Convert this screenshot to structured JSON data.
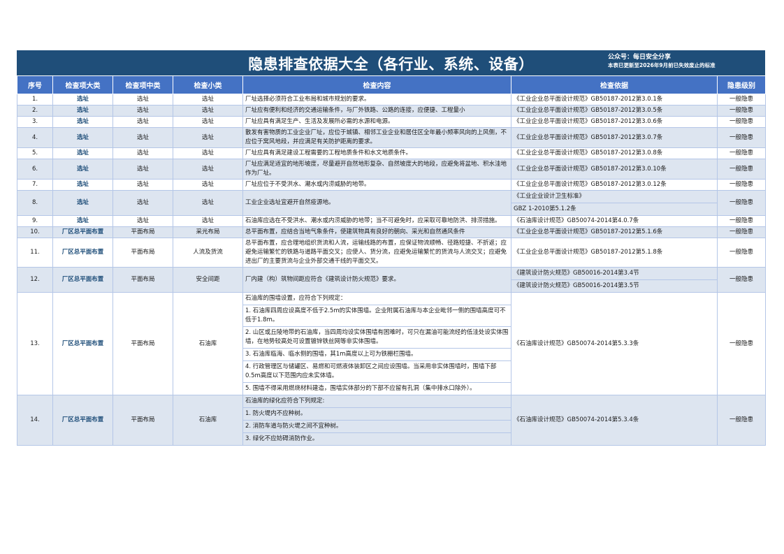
{
  "title": {
    "main": "隐患排查依据大全（各行业、系统、设备）",
    "wechat": "公众号：每日安全分享",
    "note": "本表已更新至2026年9月前已失效废止的标准"
  },
  "headers": [
    "序号",
    "检查项大类",
    "检查项中类",
    "检查小类",
    "检查内容",
    "检查依据",
    "隐患级别"
  ],
  "rows": [
    {
      "no": "1.",
      "cat": "选址",
      "mid": "选址",
      "small": "选址",
      "content": [
        "厂址选择必须符合工业布局和城市规划的要求。"
      ],
      "basis": [
        "《工业企业总平面设计规范》GB50187-2012第3.0.1条"
      ],
      "level": "一般隐患"
    },
    {
      "no": "2.",
      "cat": "选址",
      "mid": "选址",
      "small": "选址",
      "content": [
        "厂址应有便利和经济的交通运输条件，与厂外铁路、公路的连接，应便捷、工程量小"
      ],
      "basis": [
        "《工业企业总平面设计规范》GB50187-2012第3.0.5条"
      ],
      "level": "一般隐患"
    },
    {
      "no": "3.",
      "cat": "选址",
      "mid": "选址",
      "small": "选址",
      "content": [
        "厂址应具有满足生产、生活及发展所必需的水源和电源。"
      ],
      "basis": [
        "《工业企业总平面设计规范》GB50187-2012第3.0.6条"
      ],
      "level": "一般隐患"
    },
    {
      "no": "4.",
      "cat": "选址",
      "mid": "选址",
      "small": "选址",
      "content": [
        "散发有害物质的工业企业厂址，应位于城镇、相邻工业企业和居住区全年最小频率风向的上风侧，不应位于窝风地段，并应满足有关防护距离的要求。"
      ],
      "basis": [
        "《工业企业总平面设计规范》GB50187-2012第3.0.7条"
      ],
      "level": "一般隐患"
    },
    {
      "no": "5.",
      "cat": "选址",
      "mid": "选址",
      "small": "选址",
      "content": [
        "厂址应具有满足建设工程需要的工程地质条件和水文地质条件。"
      ],
      "basis": [
        "《工业企业总平面设计规范》GB50187-2012第3.0.8条"
      ],
      "level": "一般隐患"
    },
    {
      "no": "6.",
      "cat": "选址",
      "mid": "选址",
      "small": "选址",
      "content": [
        "厂址应满足适宜的地形坡度，尽量避开自然地形复杂、自然坡度大的地段，应避免将盆地、积水洼地作为厂址。"
      ],
      "basis": [
        "《工业企业总平面设计规范》GB50187-2012第3.0.10条"
      ],
      "level": "一般隐患"
    },
    {
      "no": "7.",
      "cat": "选址",
      "mid": "选址",
      "small": "选址",
      "content": [
        "厂址应位于不受洪水、潮水或内涝威胁的地带。"
      ],
      "basis": [
        "《工业企业总平面设计规范》GB50187-2012第3.0.12条"
      ],
      "level": "一般隐患"
    },
    {
      "no": "8.",
      "cat": "选址",
      "mid": "选址",
      "small": "选址",
      "content": [
        "工业企业选址宜避开自然疫源地。"
      ],
      "basis": [
        "《工业企业设计卫生标准》",
        "GBZ 1-2010第5.1.2条"
      ],
      "level": "一般隐患"
    },
    {
      "no": "9.",
      "cat": "选址",
      "mid": "选址",
      "small": "选址",
      "content": [
        "石油库应选在不受洪水、潮水或内涝威胁的地带；当不可避免时，应采取可靠地防洪、排涝措施。"
      ],
      "basis": [
        "《石油库设计规范》GB50074-2014第4.0.7条"
      ],
      "level": "一般隐患"
    },
    {
      "no": "10.",
      "cat": "厂区总平面布置",
      "mid": "平面布局",
      "small": "采光布局",
      "content": [
        "总平面布置，应结合当地气象条件，使建筑物具有良好的朝向、采光和自然通风条件"
      ],
      "basis": [
        "《工业企业总平面设计规范》GB50187-2012第5.1.6条"
      ],
      "level": "一般隐患"
    },
    {
      "no": "11.",
      "cat": "厂区总平面布置",
      "mid": "平面布局",
      "small": "人流及货流",
      "content": [
        "总平面布置，应合理地组织货流和人流，运输线路的布置，应保证物流顺畅、径路短捷、不折返；应避免运输繁忙的铁路与道路平面交叉；应使人、货分流，应避免运输繁忙的货流与人流交叉；应避免进出厂的主要货流与企业外部交通干线的平面交叉。"
      ],
      "basis": [
        "《工业企业总平面设计规范》GB50187-2012第5.1.8条"
      ],
      "level": "一般隐患"
    },
    {
      "no": "12.",
      "cat": "厂区总平面布置",
      "mid": "平面布局",
      "small": "安全间距",
      "content": [
        "厂内建（构）筑物间距应符合《建筑设计防火规范》要求。"
      ],
      "basis": [
        "《建筑设计防火规范》GB50016-2014第3.4节",
        "《建筑设计防火规范》GB50016-2014第3.5节"
      ],
      "level": "一般隐患"
    },
    {
      "no": "13.",
      "cat": "厂区总平面布置",
      "mid": "平面布局",
      "small": "石油库",
      "content": [
        "石油库的围墙设置，应符合下列规定：",
        "1. 石油库四周应设高度不低于2.5m的实体围墙。企业附属石油库与本企业毗邻一侧的围墙高度可不低于1.8m。",
        "2. 山区或丘陵地带的石油库，当四周均设实体围墙有困难时，可只在漏油可能流经的低洼处设实体围墙，在地势较高处可设置镀锌铁丝网等非实体围墙。",
        "3. 石油库临海、临水侧的围墙，其1m高度以上可为铁栅栏围墙。",
        "4. 行政管理区与储罐区、易燃和可燃液体装卸区之间应设围墙。当采用非实体围墙时，围墙下部0.5m高度以下范围内应未实体墙。",
        "5. 围墙不得采用燃烧材料建造，围墙实体部分的下部不应留有孔洞（集中排水口除外）。"
      ],
      "basis": [
        "《石油库设计规范》GB50074-2014第5.3.3条"
      ],
      "level": "一般隐患"
    },
    {
      "no": "14.",
      "cat": "厂区总平面布置",
      "mid": "平面布局",
      "small": "石油库",
      "content": [
        "石油库的绿化应符合下列规定:",
        "1. 防火堤内不应种树。",
        "2. 消防车道与防火堤之间不宜种树。",
        "3. 绿化不应妨碍消防作业。"
      ],
      "basis": [
        "《石油库设计规范》GB50074-2014第5.3.4条"
      ],
      "level": "一般隐患"
    }
  ]
}
